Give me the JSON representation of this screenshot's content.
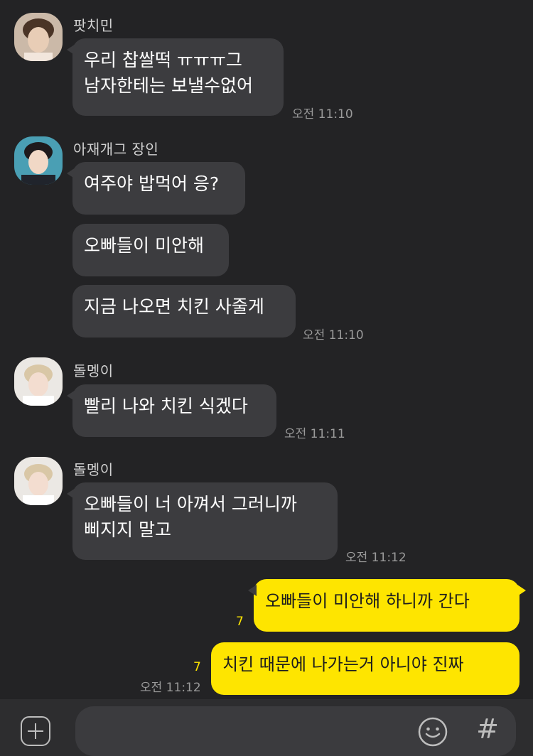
{
  "messages": [
    {
      "sender": "팟치민",
      "lines": [
        "우리 찹쌀떡 ㅠㅠㅠ그",
        "남자한테는 보낼수없어"
      ],
      "time": "오전 11:10"
    },
    {
      "sender": "아재개그 장인",
      "bubbles": [
        "여주야 밥먹어 응?",
        "오빠들이 미안해",
        "지금 나오면 치킨 사줄게"
      ],
      "time": "오전 11:10"
    },
    {
      "sender": "돌멩이",
      "text": "빨리 나와 치킨 식겠다",
      "time": "오전 11:11"
    },
    {
      "sender": "돌멩이",
      "lines": [
        "오빠들이 너 아껴서 그러니까",
        "삐지지 말고"
      ],
      "time": "오전 11:12"
    }
  ],
  "my_messages": [
    {
      "text": "오빠들이 미안해 하니까 간다",
      "unread": "7"
    },
    {
      "text": "치킨 때문에 나가는거 아니야 진짜",
      "unread": "7",
      "time": "오전 11:12"
    }
  ],
  "composer": {
    "hash_symbol": "#"
  },
  "icons": {
    "plus": "plus-square-icon",
    "emoji": "smiley-icon",
    "hash": "hashtag-icon"
  },
  "colors": {
    "background": "#232325",
    "bubble_other": "#3c3c3f",
    "bubble_me": "#fee500",
    "unread": "#fee500"
  }
}
